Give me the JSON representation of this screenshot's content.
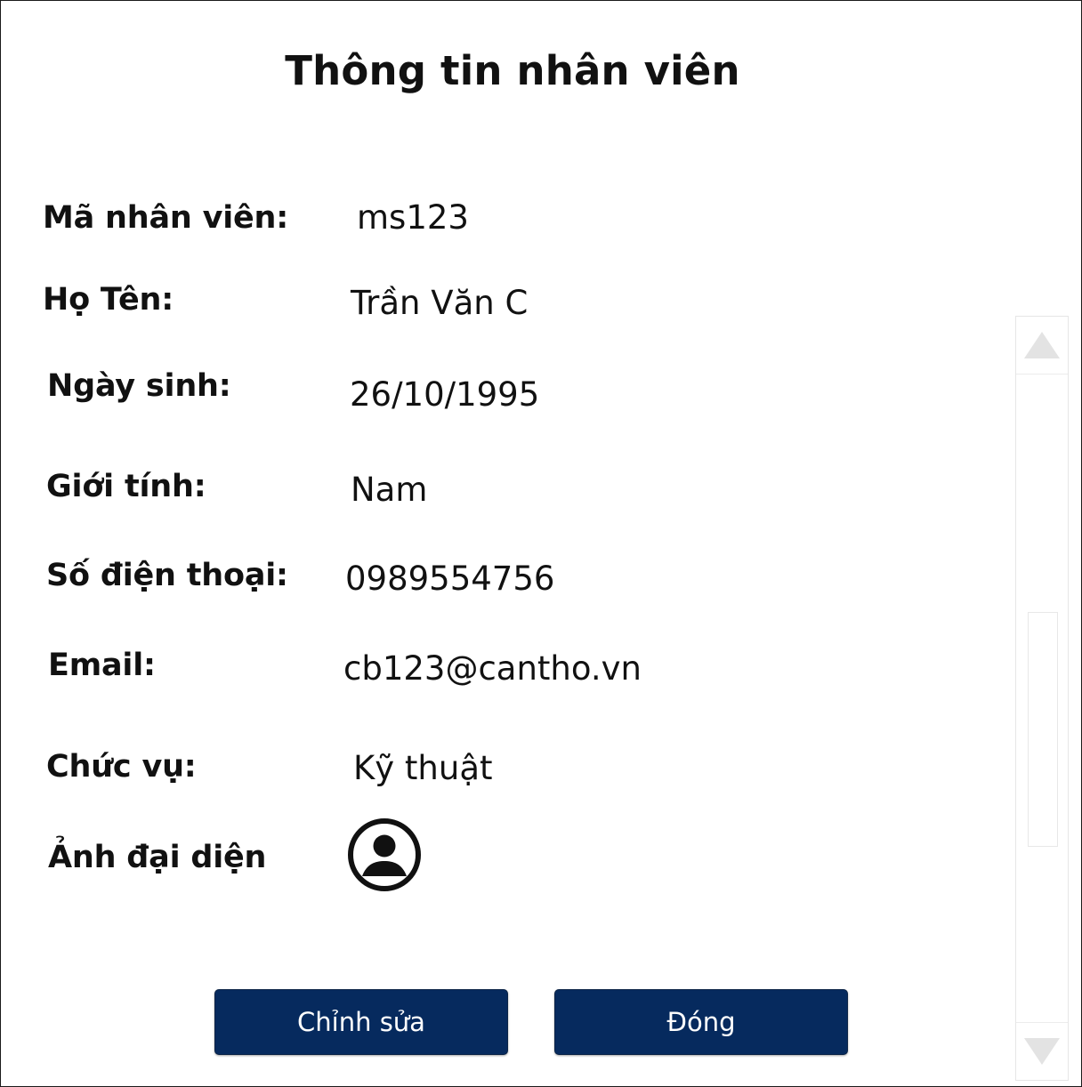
{
  "dialog": {
    "title": "Thông tin nhân viên"
  },
  "fields": {
    "employee_id": {
      "label": "Mã nhân viên:",
      "value": "ms123"
    },
    "full_name": {
      "label": "Họ Tên:",
      "value": "Trần Văn C"
    },
    "birth_date": {
      "label": "Ngày sinh:",
      "value": "26/10/1995"
    },
    "gender": {
      "label": "Giới tính:",
      "value": "Nam"
    },
    "phone": {
      "label": "Số điện thoại:",
      "value": "0989554756"
    },
    "email": {
      "label": "Email:",
      "value": "cb123@cantho.vn"
    },
    "position": {
      "label": "Chức vụ:",
      "value": "Kỹ thuật"
    },
    "avatar": {
      "label": "Ảnh đại diện",
      "icon": "user-circle-icon"
    }
  },
  "actions": {
    "edit_label": "Chỉnh sửa",
    "close_label": "Đóng"
  },
  "colors": {
    "button_bg": "#062a5e",
    "button_text": "#ffffff",
    "scrollbar_border": "#e6e6e6",
    "scroll_arrow": "#e3e3e3"
  }
}
